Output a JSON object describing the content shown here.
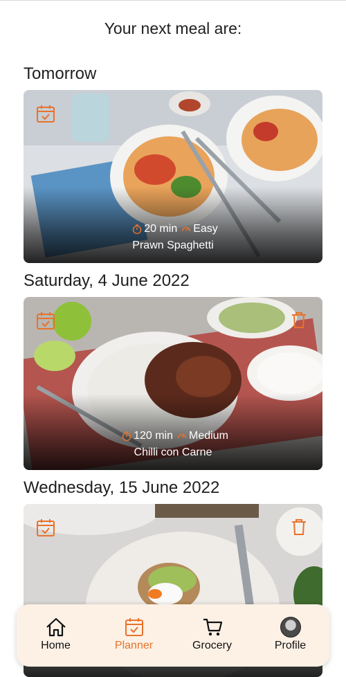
{
  "header": {
    "title": "Your next meal are:"
  },
  "meals": [
    {
      "day": "Tomorrow",
      "time": "20 min",
      "difficulty": "Easy",
      "name": "Prawn Spaghetti",
      "has_delete": false
    },
    {
      "day": "Saturday, 4 June 2022",
      "time": "120 min",
      "difficulty": "Medium",
      "name": "Chilli con Carne",
      "has_delete": true
    },
    {
      "day": "Wednesday, 15 June 2022",
      "time": "",
      "difficulty": "",
      "name": "",
      "has_delete": true
    }
  ],
  "nav": {
    "active": "Planner",
    "items": [
      {
        "label": "Home",
        "icon": "home-icon"
      },
      {
        "label": "Planner",
        "icon": "calendar-check-icon"
      },
      {
        "label": "Grocery",
        "icon": "cart-icon"
      },
      {
        "label": "Profile",
        "icon": "avatar"
      }
    ]
  },
  "colors": {
    "accent": "#e8722a",
    "nav_bg": "#fdf1e6",
    "text": "#1f1f1f"
  }
}
